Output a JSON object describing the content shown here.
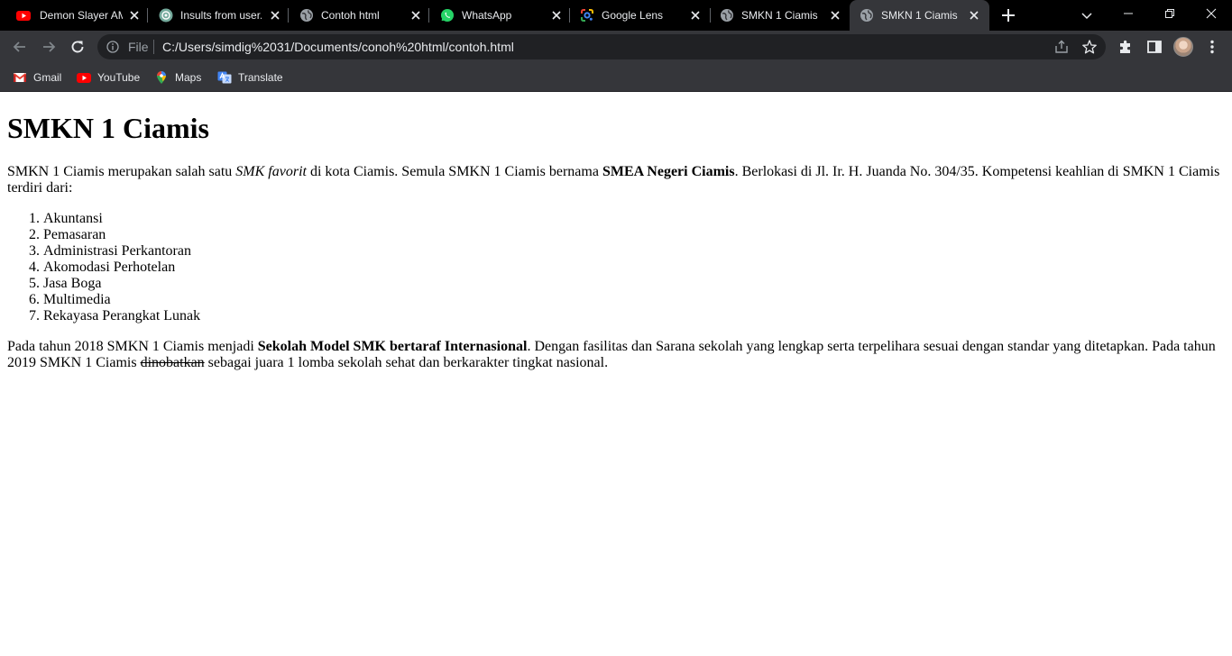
{
  "browser": {
    "tabs": [
      {
        "title": "Demon Slayer AMV",
        "favicon": "youtube-icon",
        "active": false
      },
      {
        "title": "Insults from user...",
        "favicon": "chatgpt-icon",
        "active": false
      },
      {
        "title": "Contoh html",
        "favicon": "globe-icon",
        "active": false
      },
      {
        "title": "WhatsApp",
        "favicon": "whatsapp-icon",
        "active": false
      },
      {
        "title": "Google Lens",
        "favicon": "google-lens-icon",
        "active": false
      },
      {
        "title": "SMKN 1 Ciamis",
        "favicon": "globe-icon",
        "active": false
      },
      {
        "title": "SMKN 1 Ciamis",
        "favicon": "globe-icon",
        "active": true
      }
    ],
    "omnibox": {
      "scheme_label": "File",
      "url": "C:/Users/simdig%2031/Documents/conoh%20html/contoh.html"
    },
    "bookmarks": [
      {
        "label": "Gmail",
        "icon": "gmail-icon"
      },
      {
        "label": "YouTube",
        "icon": "youtube-icon"
      },
      {
        "label": "Maps",
        "icon": "maps-icon"
      },
      {
        "label": "Translate",
        "icon": "translate-icon"
      }
    ],
    "colors": {
      "tabstrip_bg": "#000000",
      "toolbar_bg": "#35363a",
      "omnibox_bg": "#202124",
      "text": "#e8eaed"
    }
  },
  "page": {
    "heading": "SMKN 1 Ciamis",
    "para1": {
      "t1": "SMKN 1 Ciamis merupakan salah satu ",
      "em": "SMK favorit",
      "t2": " di kota Ciamis. Semula SMKN 1 Ciamis bernama ",
      "strong": "SMEA Negeri Ciamis",
      "t3": ". Berlokasi di Jl. Ir. H. Juanda No. 304/35. Kompetensi keahlian di SMKN 1 Ciamis terdiri dari:"
    },
    "list": [
      "Akuntansi",
      "Pemasaran",
      "Administrasi Perkantoran",
      "Akomodasi Perhotelan",
      "Jasa Boga",
      "Multimedia",
      "Rekayasa Perangkat Lunak"
    ],
    "para2": {
      "t1": "Pada tahun 2018 SMKN 1 Ciamis menjadi ",
      "strong": "Sekolah Model SMK bertaraf Internasional",
      "t2": ". Dengan fasilitas dan Sarana sekolah yang lengkap serta terpelihara sesuai dengan standar yang ditetapkan. Pada tahun 2019 SMKN 1 Ciamis ",
      "strike": "dinobatkan",
      "t3": " sebagai juara 1 lomba sekolah sehat dan berkarakter tingkat nasional."
    }
  }
}
